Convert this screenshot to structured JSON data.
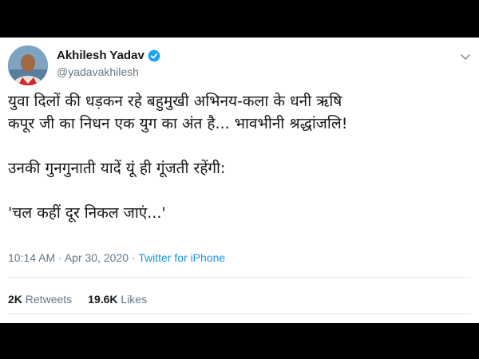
{
  "user": {
    "name": "Akhilesh Yadav",
    "handle": "@yadavakhilesh",
    "verified": true
  },
  "tweet": {
    "lines": [
      "युवा दिलों की धड़कन रहे बहुमुखी अभिनय-कला के धनी ऋषि",
      "कपूर जी का निधन एक युग का अंत है... भावभीनी श्रद्धांजलि!",
      "उनकी गुनगुनाती यादें यूं ही गूंजती रहेंगी:",
      "'चल कहीं दूर निकल जाएं...'"
    ],
    "time": "10:14 AM",
    "date": "Apr 30, 2020",
    "separator": "·",
    "source": "Twitter for iPhone"
  },
  "stats": {
    "retweets_count": "2K",
    "retweets_label": "Retweets",
    "likes_count": "19.6K",
    "likes_label": "Likes"
  },
  "colors": {
    "verified": "#1da1f2",
    "link": "#1b95e0",
    "muted": "#657786"
  },
  "icons": {
    "verified": "verified-badge-icon",
    "menu": "chevron-down-icon"
  }
}
